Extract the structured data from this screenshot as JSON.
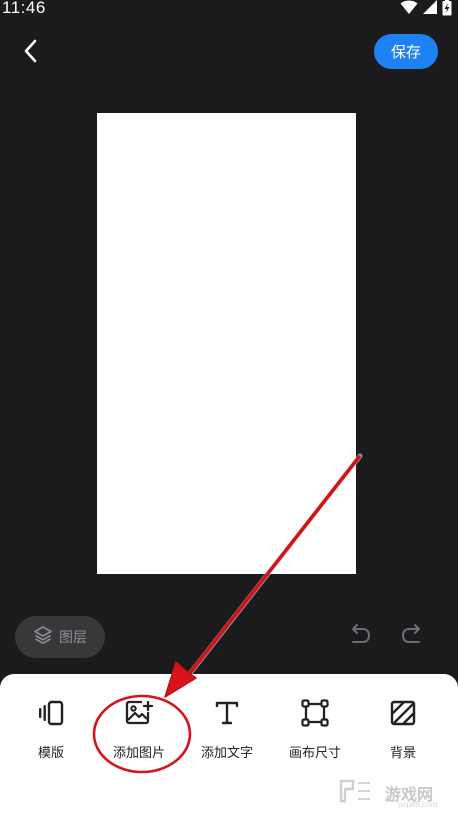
{
  "status_bar": {
    "time": "11:46",
    "icons": [
      "wifi-icon",
      "signal-icon",
      "battery-charging-icon"
    ]
  },
  "header": {
    "back_icon": "chevron-left-icon",
    "save_label": "保存",
    "accent_color": "#1e82f4"
  },
  "canvas": {
    "background_color": "#ffffff"
  },
  "layers": {
    "icon": "layers-icon",
    "label": "图层"
  },
  "history": {
    "undo_icon": "undo-icon",
    "redo_icon": "redo-icon"
  },
  "toolbar": {
    "items": [
      {
        "icon": "template-icon",
        "label": "模版"
      },
      {
        "icon": "add-image-icon",
        "label": "添加图片"
      },
      {
        "icon": "text-icon",
        "label": "添加文字"
      },
      {
        "icon": "canvas-size-icon",
        "label": "画布尺寸"
      },
      {
        "icon": "background-icon",
        "label": "背景"
      }
    ]
  },
  "annotation": {
    "color": "#d8141b",
    "highlighted_item": "添加图片"
  },
  "watermark": {
    "text": "游戏网",
    "url": "pcp89.com"
  }
}
